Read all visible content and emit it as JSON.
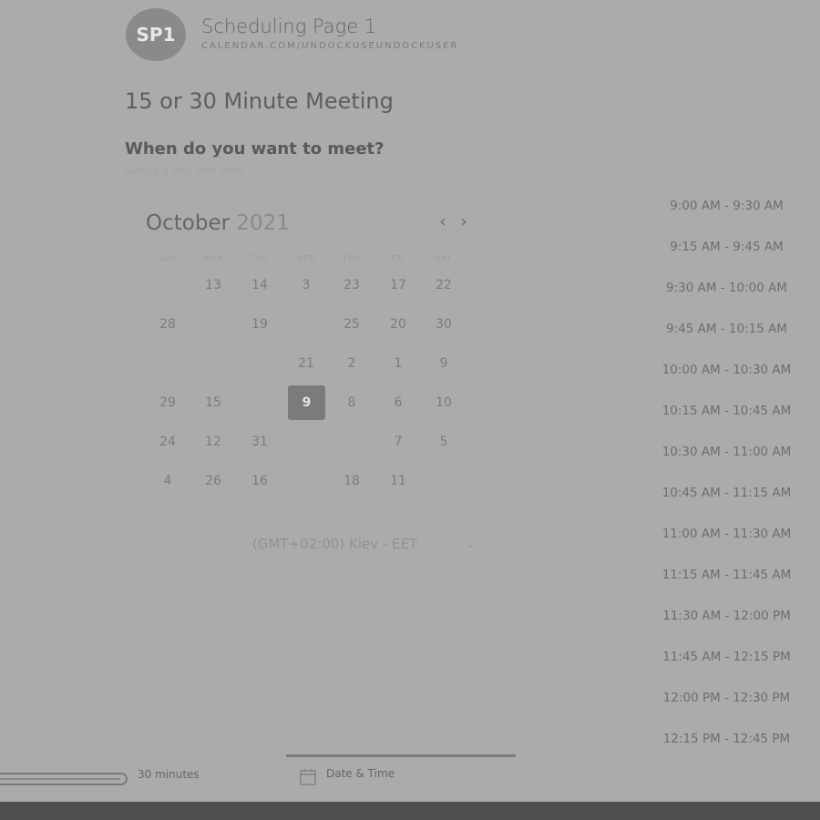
{
  "header": {
    "avatar_initials": "SP1",
    "title": "Scheduling Page 1",
    "url": "CALENDAR.COM/UNDOCKUSEUNDOCKUSER"
  },
  "meeting": {
    "title": "15 or 30 Minute Meeting",
    "question": "When do you want to meet?",
    "subtext": "Select a day and time"
  },
  "calendar": {
    "month": "October",
    "year": "2021",
    "prev_icon": "chevron-left-icon",
    "next_icon": "chevron-right-icon",
    "weekdays": [
      "SUN",
      "MON",
      "TUE",
      "WED",
      "THU",
      "FRI",
      "SAT"
    ],
    "days": [
      {
        "label": "13",
        "row": 0,
        "col": 1
      },
      {
        "label": "14",
        "row": 0,
        "col": 2
      },
      {
        "label": "3",
        "row": 0,
        "col": 3
      },
      {
        "label": "23",
        "row": 0,
        "col": 4
      },
      {
        "label": "17",
        "row": 0,
        "col": 5
      },
      {
        "label": "22",
        "row": 0,
        "col": 6
      },
      {
        "label": "28",
        "row": 1,
        "col": 0
      },
      {
        "label": "19",
        "row": 1,
        "col": 2
      },
      {
        "label": "25",
        "row": 1,
        "col": 4
      },
      {
        "label": "20",
        "row": 1,
        "col": 5
      },
      {
        "label": "30",
        "row": 1,
        "col": 6
      },
      {
        "label": "21",
        "row": 2,
        "col": 3
      },
      {
        "label": "2",
        "row": 2,
        "col": 4
      },
      {
        "label": "1",
        "row": 2,
        "col": 5
      },
      {
        "label": "9",
        "row": 2,
        "col": 6
      },
      {
        "label": "29",
        "row": 3,
        "col": 0
      },
      {
        "label": "15",
        "row": 3,
        "col": 1
      },
      {
        "label": "9",
        "row": 3,
        "col": 3,
        "selected": true
      },
      {
        "label": "8",
        "row": 3,
        "col": 4
      },
      {
        "label": "6",
        "row": 3,
        "col": 5
      },
      {
        "label": "10",
        "row": 3,
        "col": 6
      },
      {
        "label": "24",
        "row": 4,
        "col": 0
      },
      {
        "label": "12",
        "row": 4,
        "col": 1
      },
      {
        "label": "31",
        "row": 4,
        "col": 2
      },
      {
        "label": "7",
        "row": 4,
        "col": 5
      },
      {
        "label": "5",
        "row": 4,
        "col": 6
      },
      {
        "label": "4",
        "row": 5,
        "col": 0
      },
      {
        "label": "26",
        "row": 5,
        "col": 1
      },
      {
        "label": "16",
        "row": 5,
        "col": 2
      },
      {
        "label": "18",
        "row": 5,
        "col": 4
      },
      {
        "label": "11",
        "row": 5,
        "col": 5
      }
    ]
  },
  "timezone": {
    "value": "(GMT+02:00) Kiev - EET",
    "icon": "chevron-down-icon"
  },
  "time_slots": [
    "9:00 AM - 9:30 AM",
    "9:15 AM - 9:45 AM",
    "9:30 AM - 10:00 AM",
    "9:45 AM - 10:15 AM",
    "10:00 AM - 10:30 AM",
    "10:15 AM - 10:45 AM",
    "10:30 AM - 11:00 AM",
    "10:45 AM - 11:15 AM",
    "11:00 AM - 11:30 AM",
    "11:15 AM - 11:45 AM",
    "11:30 AM - 12:00 PM",
    "11:45 AM - 12:15 PM",
    "12:00 PM - 12:30 PM",
    "12:15 PM - 12:45 PM"
  ],
  "steps": {
    "duration": {
      "label": "30 minutes",
      "sub": "HOW LONG"
    },
    "datetime": {
      "label": "Date & Time",
      "sub": "WHEN",
      "icon": "calendar-icon"
    }
  },
  "colors": {
    "background": "#ababab",
    "selected_day": "#7b7b7b",
    "bottom_bar": "#4f4f4f"
  }
}
